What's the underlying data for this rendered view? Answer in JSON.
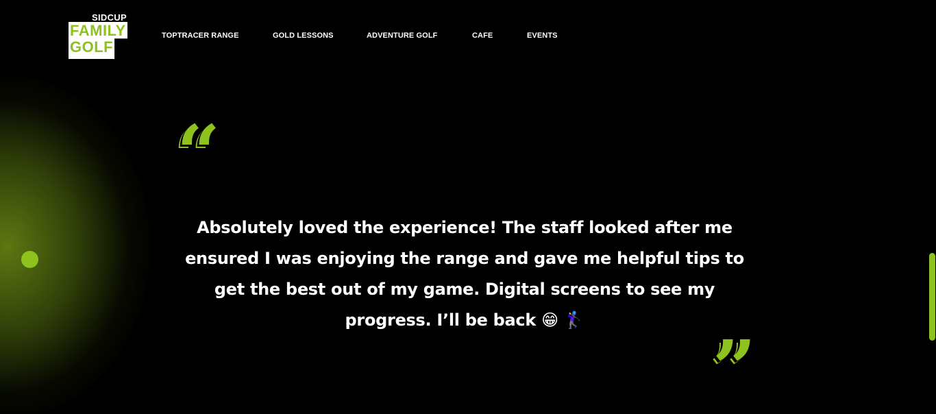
{
  "brand": {
    "top_label": "SIDCUP",
    "line1": "FAMILY",
    "line2": "GOLF",
    "accent_color": "#8dc21f"
  },
  "nav": {
    "items": [
      {
        "label": "TOPTRACER RANGE"
      },
      {
        "label": "GOLD LESSONS"
      },
      {
        "label": "ADVENTURE GOLF"
      },
      {
        "label": "CAFE"
      },
      {
        "label": "EVENTS"
      }
    ]
  },
  "testimonial": {
    "open_mark": "“",
    "close_mark": "”",
    "text": "Absolutely loved the experience! The staff looked after me ensured I was enjoying the range and gave me helpful tips to get the best out of my game. Digital screens to see my progress. I’ll be back 😁 🏌️‍♀️"
  },
  "colors": {
    "background": "#000000",
    "accent": "#8dc21f",
    "text": "#ffffff"
  }
}
